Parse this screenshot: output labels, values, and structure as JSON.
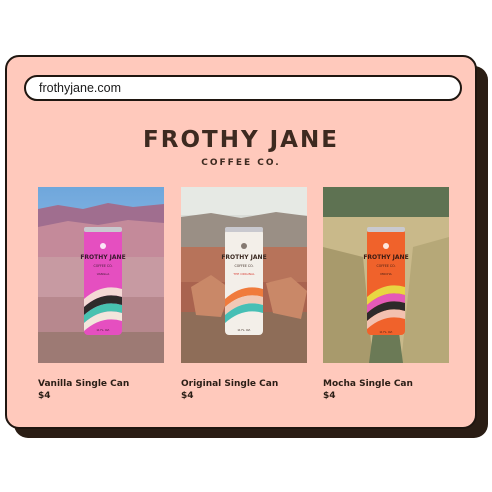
{
  "browser": {
    "url": "frothyjane.com"
  },
  "header": {
    "brand": "FROTHY JANE",
    "subtitle": "COFFEE CO."
  },
  "products": [
    {
      "name": "Vanilla Single Can",
      "price": "$4",
      "can_color": "#e54fc0",
      "can_label": "FROTHY JANE",
      "can_sub": "COFFEE CO.",
      "can_flavor": "VANILLA",
      "can_size": "11 FL. OZ."
    },
    {
      "name": "Original Single Can",
      "price": "$4",
      "can_color": "#f3efe9",
      "can_label": "FROTHY JANE",
      "can_sub": "COFFEE CO.",
      "can_flavor": "THE ORIGINAL",
      "can_size": "11 FL. OZ."
    },
    {
      "name": "Mocha Single Can",
      "price": "$4",
      "can_color": "#f0622b",
      "can_label": "FROTHY JANE",
      "can_sub": "COFFEE CO.",
      "can_flavor": "MOCHA",
      "can_size": "11 FL. OZ."
    }
  ],
  "colors": {
    "window_bg": "#ffc9bc",
    "brand_text": "#3d2a20",
    "outline": "#1f1610"
  }
}
